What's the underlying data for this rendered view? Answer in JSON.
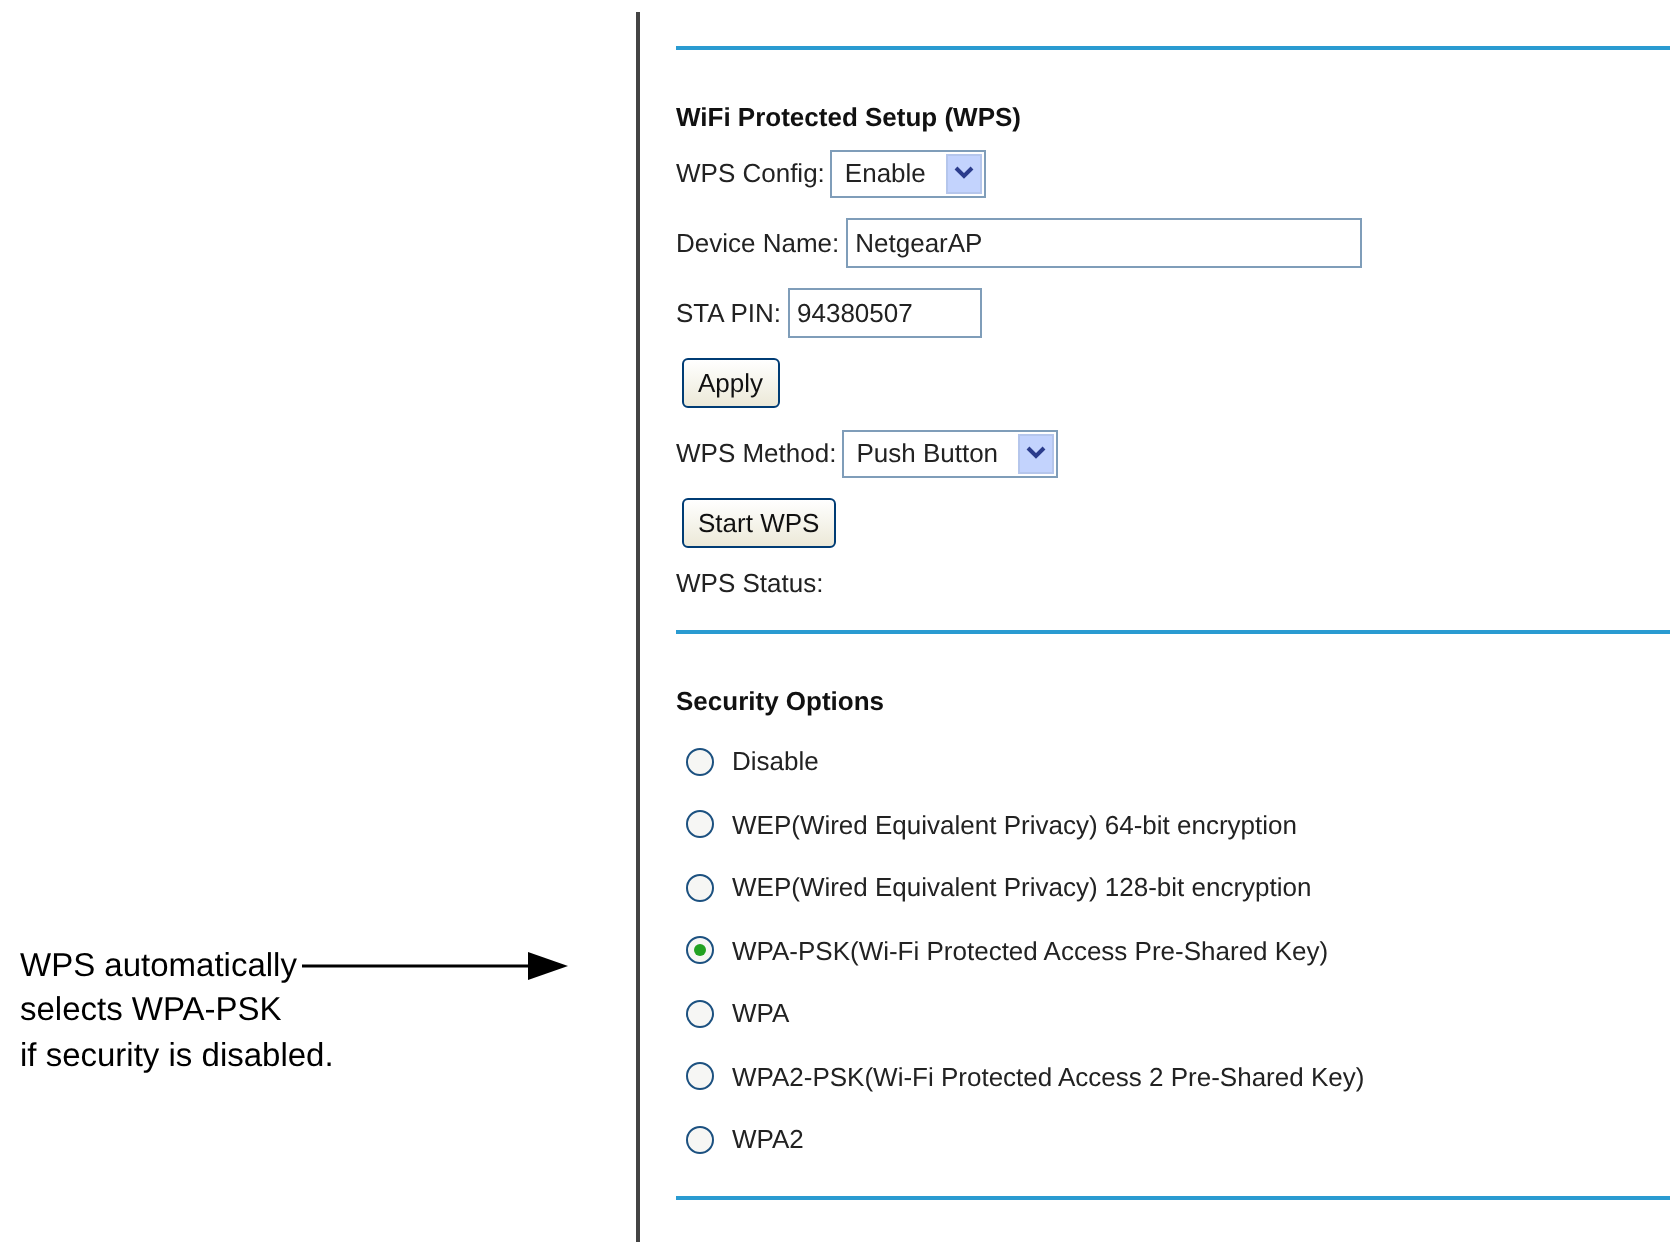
{
  "wps": {
    "title": "WiFi Protected Setup (WPS)",
    "rows": [
      {
        "kind": "select",
        "label": "WPS Config:",
        "value": "Enable"
      },
      {
        "kind": "text",
        "label": "Device Name:",
        "value": "NetgearAP"
      },
      {
        "kind": "text",
        "label": "STA PIN:",
        "value": "94380507"
      },
      {
        "kind": "button",
        "label": "Apply"
      },
      {
        "kind": "select",
        "label": "WPS Method:",
        "value": "Push Button"
      },
      {
        "kind": "button",
        "label": "Start WPS"
      },
      {
        "kind": "status",
        "label": "WPS Status:"
      }
    ]
  },
  "security": {
    "title": "Security Options",
    "options": [
      {
        "label": "Disable",
        "selected": false
      },
      {
        "label": "WEP(Wired Equivalent Privacy) 64-bit encryption",
        "selected": false
      },
      {
        "label": "WEP(Wired Equivalent Privacy) 128-bit encryption",
        "selected": false
      },
      {
        "label": "WPA-PSK(Wi-Fi Protected Access Pre-Shared Key)",
        "selected": true
      },
      {
        "label": "WPA",
        "selected": false
      },
      {
        "label": "WPA2-PSK(Wi-Fi Protected Access 2 Pre-Shared Key)",
        "selected": false
      },
      {
        "label": "WPA2",
        "selected": false
      }
    ]
  },
  "callout": {
    "lines": [
      "WPS automatically",
      "selects WPA-PSK",
      "if security is disabled."
    ]
  }
}
